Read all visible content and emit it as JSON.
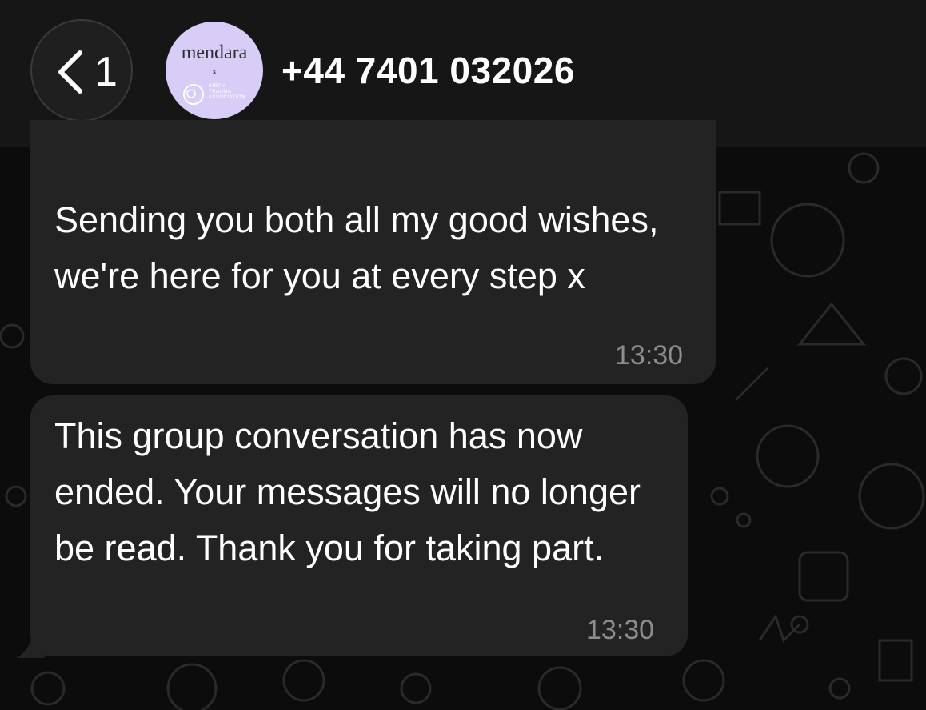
{
  "header": {
    "back_count": "1",
    "contact_name": "+44 7401 032026",
    "avatar": {
      "brand": "mendara",
      "separator": "x",
      "org_line1": "BIRTH",
      "org_line2": "TRAUMA",
      "org_line3": "ASSOCIATION"
    }
  },
  "messages": [
    {
      "text": "Sending you both all my good wishes, we're here for you at every step x",
      "time": "13:30"
    },
    {
      "text": "This group conversation has now ended. Your messages will no longer be read. Thank you for taking part.",
      "time": "13:30"
    }
  ],
  "colors": {
    "background": "#0c0c0c",
    "header": "#161616",
    "bubble": "#232324",
    "timestamp": "#8d8d8d",
    "avatar": "#d7cdf7"
  },
  "icons": [
    "chevron-left-icon",
    "chat-wallpaper-doodles",
    "birth-trauma-logo-icon"
  ]
}
